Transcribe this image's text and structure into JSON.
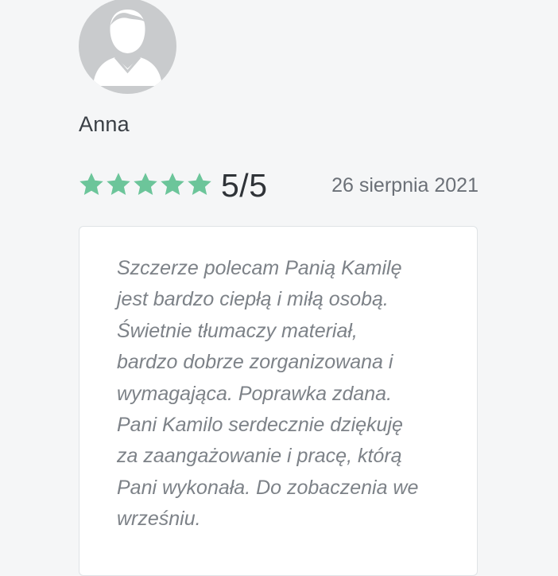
{
  "reviewer": {
    "name": "Anna",
    "avatar_icon": "user-avatar-icon"
  },
  "rating": {
    "value": 5,
    "max": 5,
    "score_text": "5/5",
    "star_color": "#6cc59a",
    "star_icon": "star-icon"
  },
  "review": {
    "date": "26 sierpnia 2021",
    "text": "Szczerze polecam Panią Kamilę\njest bardzo ciepłą i miłą osobą.\nŚwietnie tłumaczy materiał,\nbardzo dobrze zorganizowana i\nwymagająca. Poprawka zdana.\nPani Kamilo serdecznie dziękuję\nza zaangażowanie i pracę, którą\nPani wykonała. Do zobaczenia we\nwrześniu."
  }
}
